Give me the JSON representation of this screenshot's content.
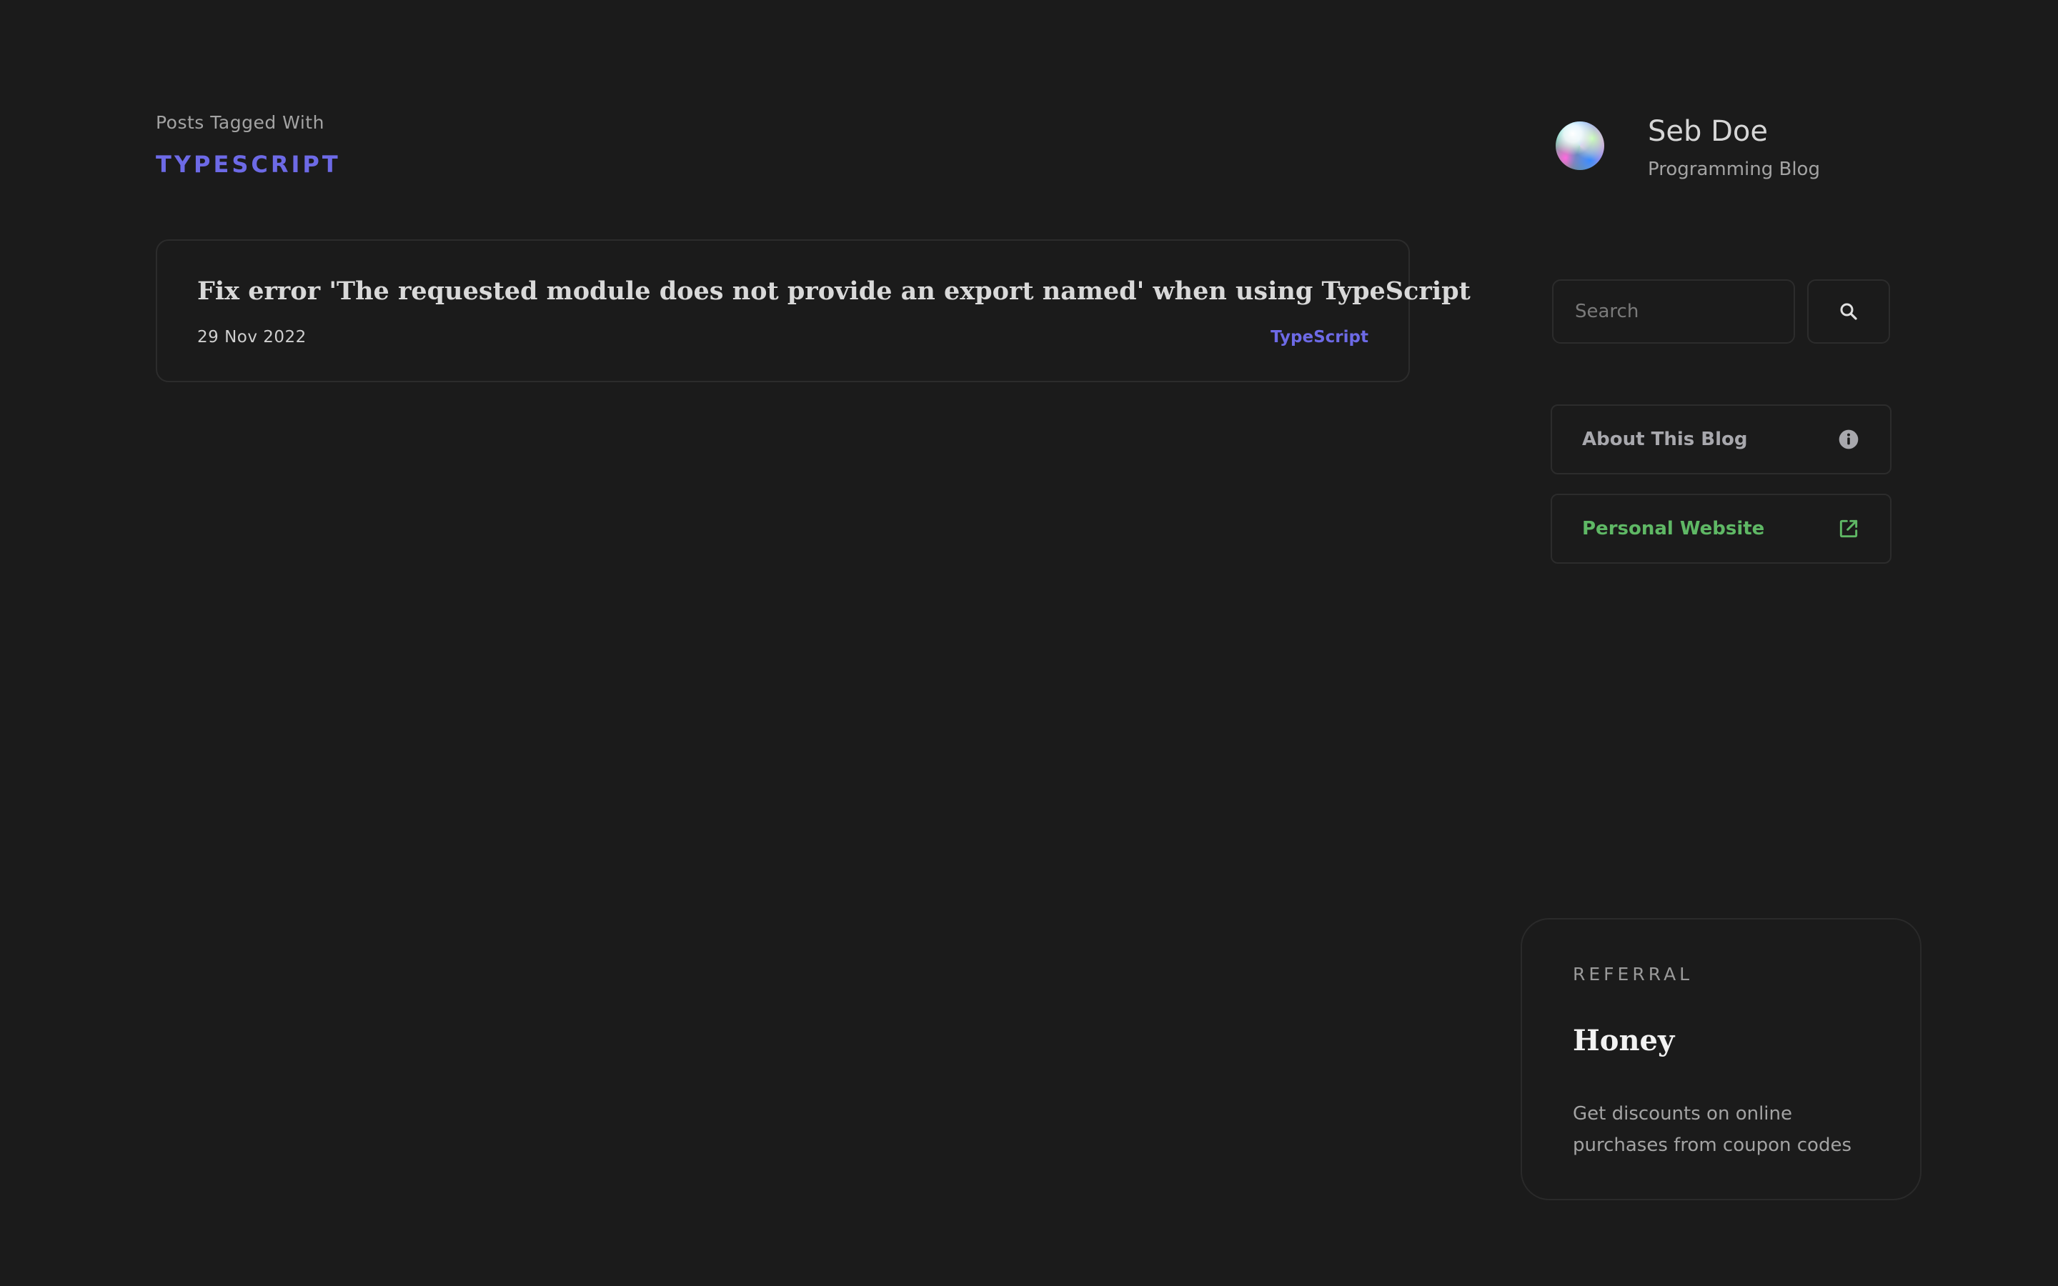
{
  "tag_page": {
    "kicker": "Posts Tagged With",
    "tag": "TYPESCRIPT"
  },
  "posts": [
    {
      "title": "Fix error 'The requested module does not provide an export named' when using TypeScript",
      "date": "29 Nov 2022",
      "tag": "TypeScript"
    }
  ],
  "profile": {
    "name": "Seb Doe",
    "subtitle": "Programming Blog"
  },
  "search": {
    "placeholder": "Search",
    "value": "",
    "button_icon": "search-icon"
  },
  "sidebar_links": [
    {
      "label": "About This Blog",
      "icon": "info-icon",
      "color": "#a8a8ad"
    },
    {
      "label": "Personal Website",
      "icon": "external-link-icon",
      "color": "#5fb865"
    }
  ],
  "referral": {
    "kicker": "REFERRAL",
    "title": "Honey",
    "description": "Get discounts on online purchases from coupon codes"
  },
  "colors": {
    "background": "#1b1b1b",
    "accent": "#6d6ae6",
    "link_green": "#5fb865",
    "border": "#2c2c2c"
  }
}
